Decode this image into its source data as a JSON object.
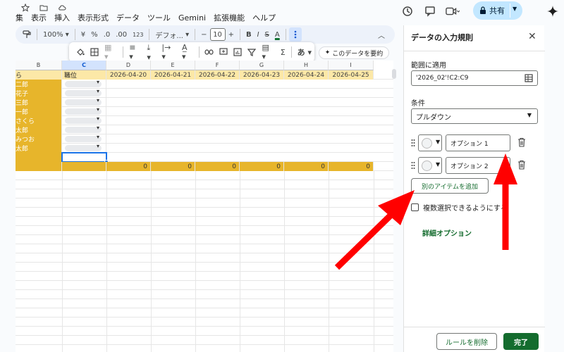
{
  "menu": [
    "集",
    "表示",
    "挿入",
    "表示形式",
    "データ",
    "ツール",
    "Gemini",
    "拡張機能",
    "ヘルプ"
  ],
  "header": {
    "share_label": "共有"
  },
  "toolbar": {
    "zoom": "100%",
    "currency": "¥",
    "percent": "%",
    "dec_less": ".0",
    "dec_more": ".00",
    "number_format": "123",
    "font": "デフォ...",
    "font_size": "10",
    "minus": "−",
    "plus": "+",
    "bold": "B",
    "italic": "I",
    "strike": "S",
    "text_color": "A"
  },
  "toolbar2": {
    "sum": "Σ",
    "ime": "あ",
    "summarize_label": "このデータを要約"
  },
  "sheet": {
    "columns": [
      "B",
      "C",
      "D",
      "E",
      "F",
      "G",
      "H",
      "I"
    ],
    "header_row": {
      "b": "ら",
      "c": "職位",
      "dates": [
        "2026-04-20",
        "2026-04-21",
        "2026-04-22",
        "2026-04-23",
        "2026-04-24",
        "2026-04-25"
      ]
    },
    "names": [
      "二郎",
      "花子",
      "三郎",
      "一郎",
      "さくら",
      "太郎",
      "みつお",
      "太郎"
    ],
    "totals": [
      "0",
      "0",
      "0",
      "0",
      "0",
      "0"
    ]
  },
  "panel": {
    "title": "データの入力規則",
    "range_label": "範囲に適用",
    "range_value": "'2026_02'!C2:C9",
    "condition_label": "条件",
    "condition_value": "プルダウン",
    "options": [
      "オプション 1",
      "オプション 2"
    ],
    "add_item_label": "別のアイテムを追加",
    "multi_select_label": "複数選択できるようにする",
    "advanced_label": "詳細オプション",
    "remove_label": "ルールを削除",
    "done_label": "完了"
  },
  "colors": {
    "accent_green": "#146c2e",
    "header_yellow": "#fce8a7",
    "name_gold": "#e7b52b",
    "share_blue": "#c2e7ff",
    "arrow_red": "#ff0000"
  }
}
